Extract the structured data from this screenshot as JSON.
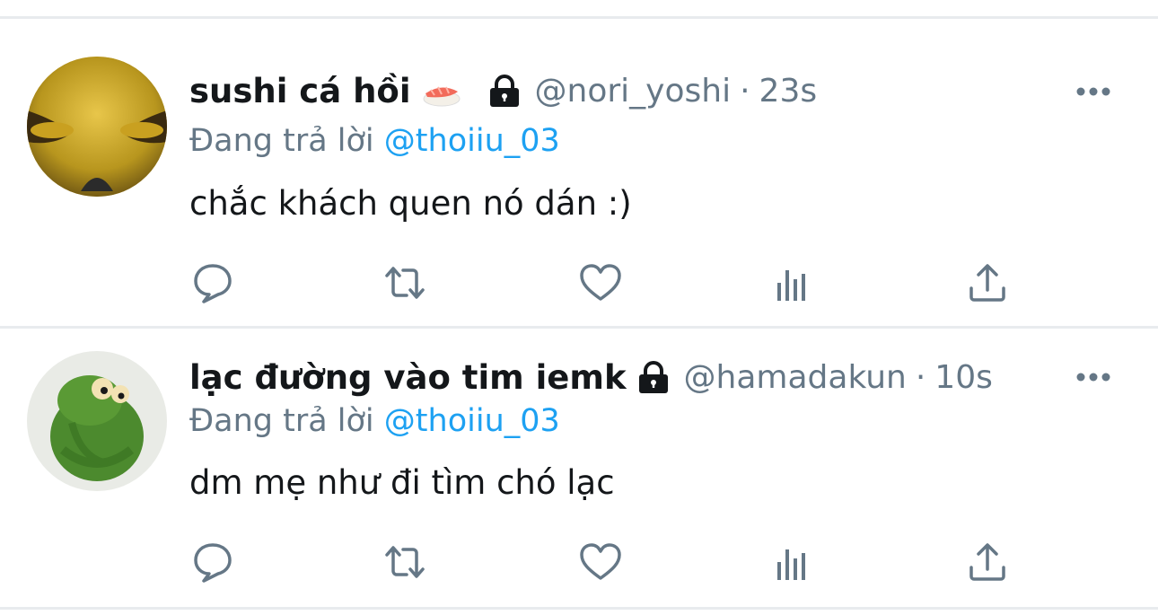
{
  "tweets": [
    {
      "display_name": "sushi cá hồi",
      "name_emoji": "sushi-emoji",
      "protected_icon": "lock-icon",
      "handle": "@nori_yoshi",
      "separator": "·",
      "time": "23s",
      "reply_prefix": "Đang trả lời",
      "reply_to": "@thoiiu_03",
      "text": "chắc khách quen nó dán :)",
      "actions": [
        "reply-icon",
        "retweet-icon",
        "like-icon",
        "analytics-icon",
        "share-icon"
      ]
    },
    {
      "display_name": "lạc đường vào tim iemk",
      "protected_icon": "lock-icon",
      "handle": "@hamadakun",
      "separator": "·",
      "time": "10s",
      "reply_prefix": "Đang trả lời",
      "reply_to": "@thoiiu_03",
      "text": "dm mẹ như đi tìm chó lạc",
      "actions": [
        "reply-icon",
        "retweet-icon",
        "like-icon",
        "analytics-icon",
        "share-icon"
      ]
    }
  ],
  "colors": {
    "text_primary": "#14171a",
    "text_secondary": "#657786",
    "link": "#1da1f2",
    "divider": "#e8ebee",
    "icon": "#657786"
  }
}
